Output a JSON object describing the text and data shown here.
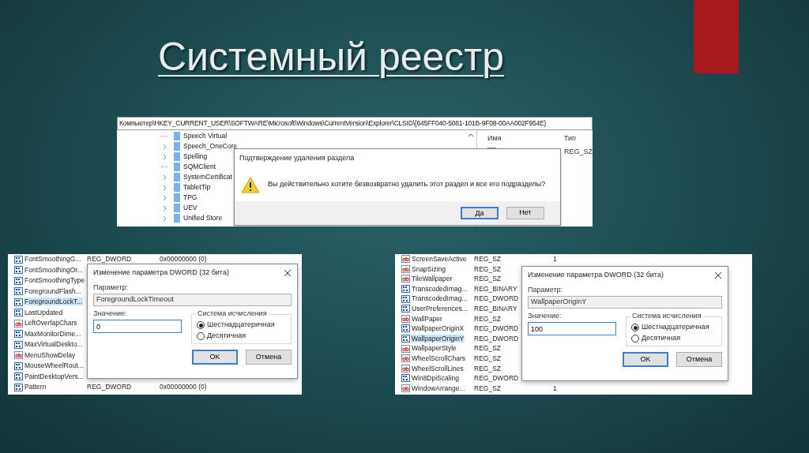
{
  "slide": {
    "title": "Системный реестр"
  },
  "registry_window": {
    "address": "Компьютер\\HKEY_CURRENT_USER\\SOFTWARE\\Microsoft\\Windows\\CurrentVersion\\Explorer\\CLSID\\{645FF040-5081-101B-9F08-00AA002F954E}",
    "tree_items": [
      {
        "label": "Speech Virtual",
        "expandable": false
      },
      {
        "label": "Speech_OneCore",
        "expandable": true
      },
      {
        "label": "Spelling",
        "expandable": true
      },
      {
        "label": "SQMClient",
        "expandable": false
      },
      {
        "label": "SystemCertificat",
        "expandable": true
      },
      {
        "label": "TabletTip",
        "expandable": true
      },
      {
        "label": "TPG",
        "expandable": true
      },
      {
        "label": "UEV",
        "expandable": true
      },
      {
        "label": "Unified Store",
        "expandable": true
      }
    ],
    "columns": [
      "Имя",
      "Тип"
    ],
    "value_type": "REG_SZ"
  },
  "delete_dialog": {
    "title": "Подтверждение удаления раздела",
    "message": "Вы действительно хотите безвозвратно удалить этот раздел и все его подразделы?",
    "buttons": [
      {
        "label": "Да",
        "default": true
      },
      {
        "label": "Нет",
        "default": false
      }
    ]
  },
  "value_lists": [
    {
      "rows": [
        {
          "name": "FontSmoothingG...",
          "kind": "binary",
          "type": "REG_DWORD",
          "data": "0x00000000 (0)",
          "selected": false
        },
        {
          "name": "FontSmoothingOr...",
          "kind": "binary",
          "selected": false
        },
        {
          "name": "FontSmoothingType",
          "kind": "binary",
          "selected": false
        },
        {
          "name": "ForegroundFlash...",
          "kind": "binary",
          "selected": false
        },
        {
          "name": "ForegroundLockT...",
          "kind": "binary",
          "selected": true
        },
        {
          "name": "LastUpdated",
          "kind": "binary",
          "selected": false
        },
        {
          "name": "LeftOverlapChars",
          "kind": "string",
          "selected": false
        },
        {
          "name": "MaxMonitorDime...",
          "kind": "binary",
          "selected": false
        },
        {
          "name": "MaxVirtualDeskto...",
          "kind": "binary",
          "selected": false
        },
        {
          "name": "MenuShowDelay",
          "kind": "string",
          "selected": false
        },
        {
          "name": "MouseWheelRout...",
          "kind": "binary",
          "selected": false
        },
        {
          "name": "PaintDesktopVers...",
          "kind": "binary",
          "selected": false
        },
        {
          "name": "Pattern",
          "kind": "binary",
          "type": "REG_DWORD",
          "data": "0x00000000 (0)",
          "selected": false
        }
      ],
      "dialog": {
        "title": "Изменение параметра DWORD (32 бита)",
        "parameter_label": "Параметр:",
        "parameter": "ForegroundLockTimeout",
        "value_label": "Значение:",
        "value": "0",
        "base_label": "Система исчисления",
        "options": [
          {
            "label": "Шестнадцатеричная",
            "selected": true
          },
          {
            "label": "Десятичная",
            "selected": false
          }
        ],
        "buttons": [
          {
            "label": "OK",
            "default": true
          },
          {
            "label": "Отмена",
            "default": false
          }
        ]
      }
    },
    {
      "rows": [
        {
          "name": "ScreenSaveActive",
          "kind": "string",
          "type": "REG_SZ",
          "data": "1",
          "selected": false
        },
        {
          "name": "SnapSizing",
          "kind": "string",
          "type": "REG_SZ",
          "selected": false
        },
        {
          "name": "TileWallpaper",
          "kind": "string",
          "type": "REG_SZ",
          "selected": false
        },
        {
          "name": "TranscodedImag...",
          "kind": "binary",
          "type": "REG_BINARY",
          "selected": false
        },
        {
          "name": "TranscodedImag...",
          "kind": "binary",
          "type": "REG_DWORD",
          "selected": false
        },
        {
          "name": "UserPreferences...",
          "kind": "binary",
          "type": "REG_BINARY",
          "selected": false
        },
        {
          "name": "WallPaper",
          "kind": "string",
          "type": "REG_SZ",
          "selected": false
        },
        {
          "name": "WallpaperOriginX",
          "kind": "binary",
          "type": "REG_DWORD",
          "selected": false
        },
        {
          "name": "WallpaperOriginY",
          "kind": "binary",
          "type": "REG_DWORD",
          "selected": true
        },
        {
          "name": "WallpaperStyle",
          "kind": "string",
          "type": "REG_SZ",
          "selected": false
        },
        {
          "name": "WheelScrollChars",
          "kind": "string",
          "type": "REG_SZ",
          "selected": false
        },
        {
          "name": "WheelScrollLines",
          "kind": "string",
          "type": "REG_SZ",
          "selected": false
        },
        {
          "name": "Win8DpiScaling",
          "kind": "binary",
          "type": "REG_DWORD",
          "selected": false
        },
        {
          "name": "WindowArrange...",
          "kind": "string",
          "type": "REG_SZ",
          "data": "1",
          "selected": false
        }
      ],
      "dialog": {
        "title": "Изменение параметра DWORD (32 бита)",
        "parameter_label": "Параметр:",
        "parameter": "WallpaperOriginY",
        "value_label": "Значение:",
        "value": "100",
        "base_label": "Система исчисления",
        "options": [
          {
            "label": "Шестнадцатеричная",
            "selected": true
          },
          {
            "label": "Десятичная",
            "selected": false
          }
        ],
        "buttons": [
          {
            "label": "OK",
            "default": true
          },
          {
            "label": "Отмена",
            "default": false
          }
        ]
      }
    }
  ]
}
